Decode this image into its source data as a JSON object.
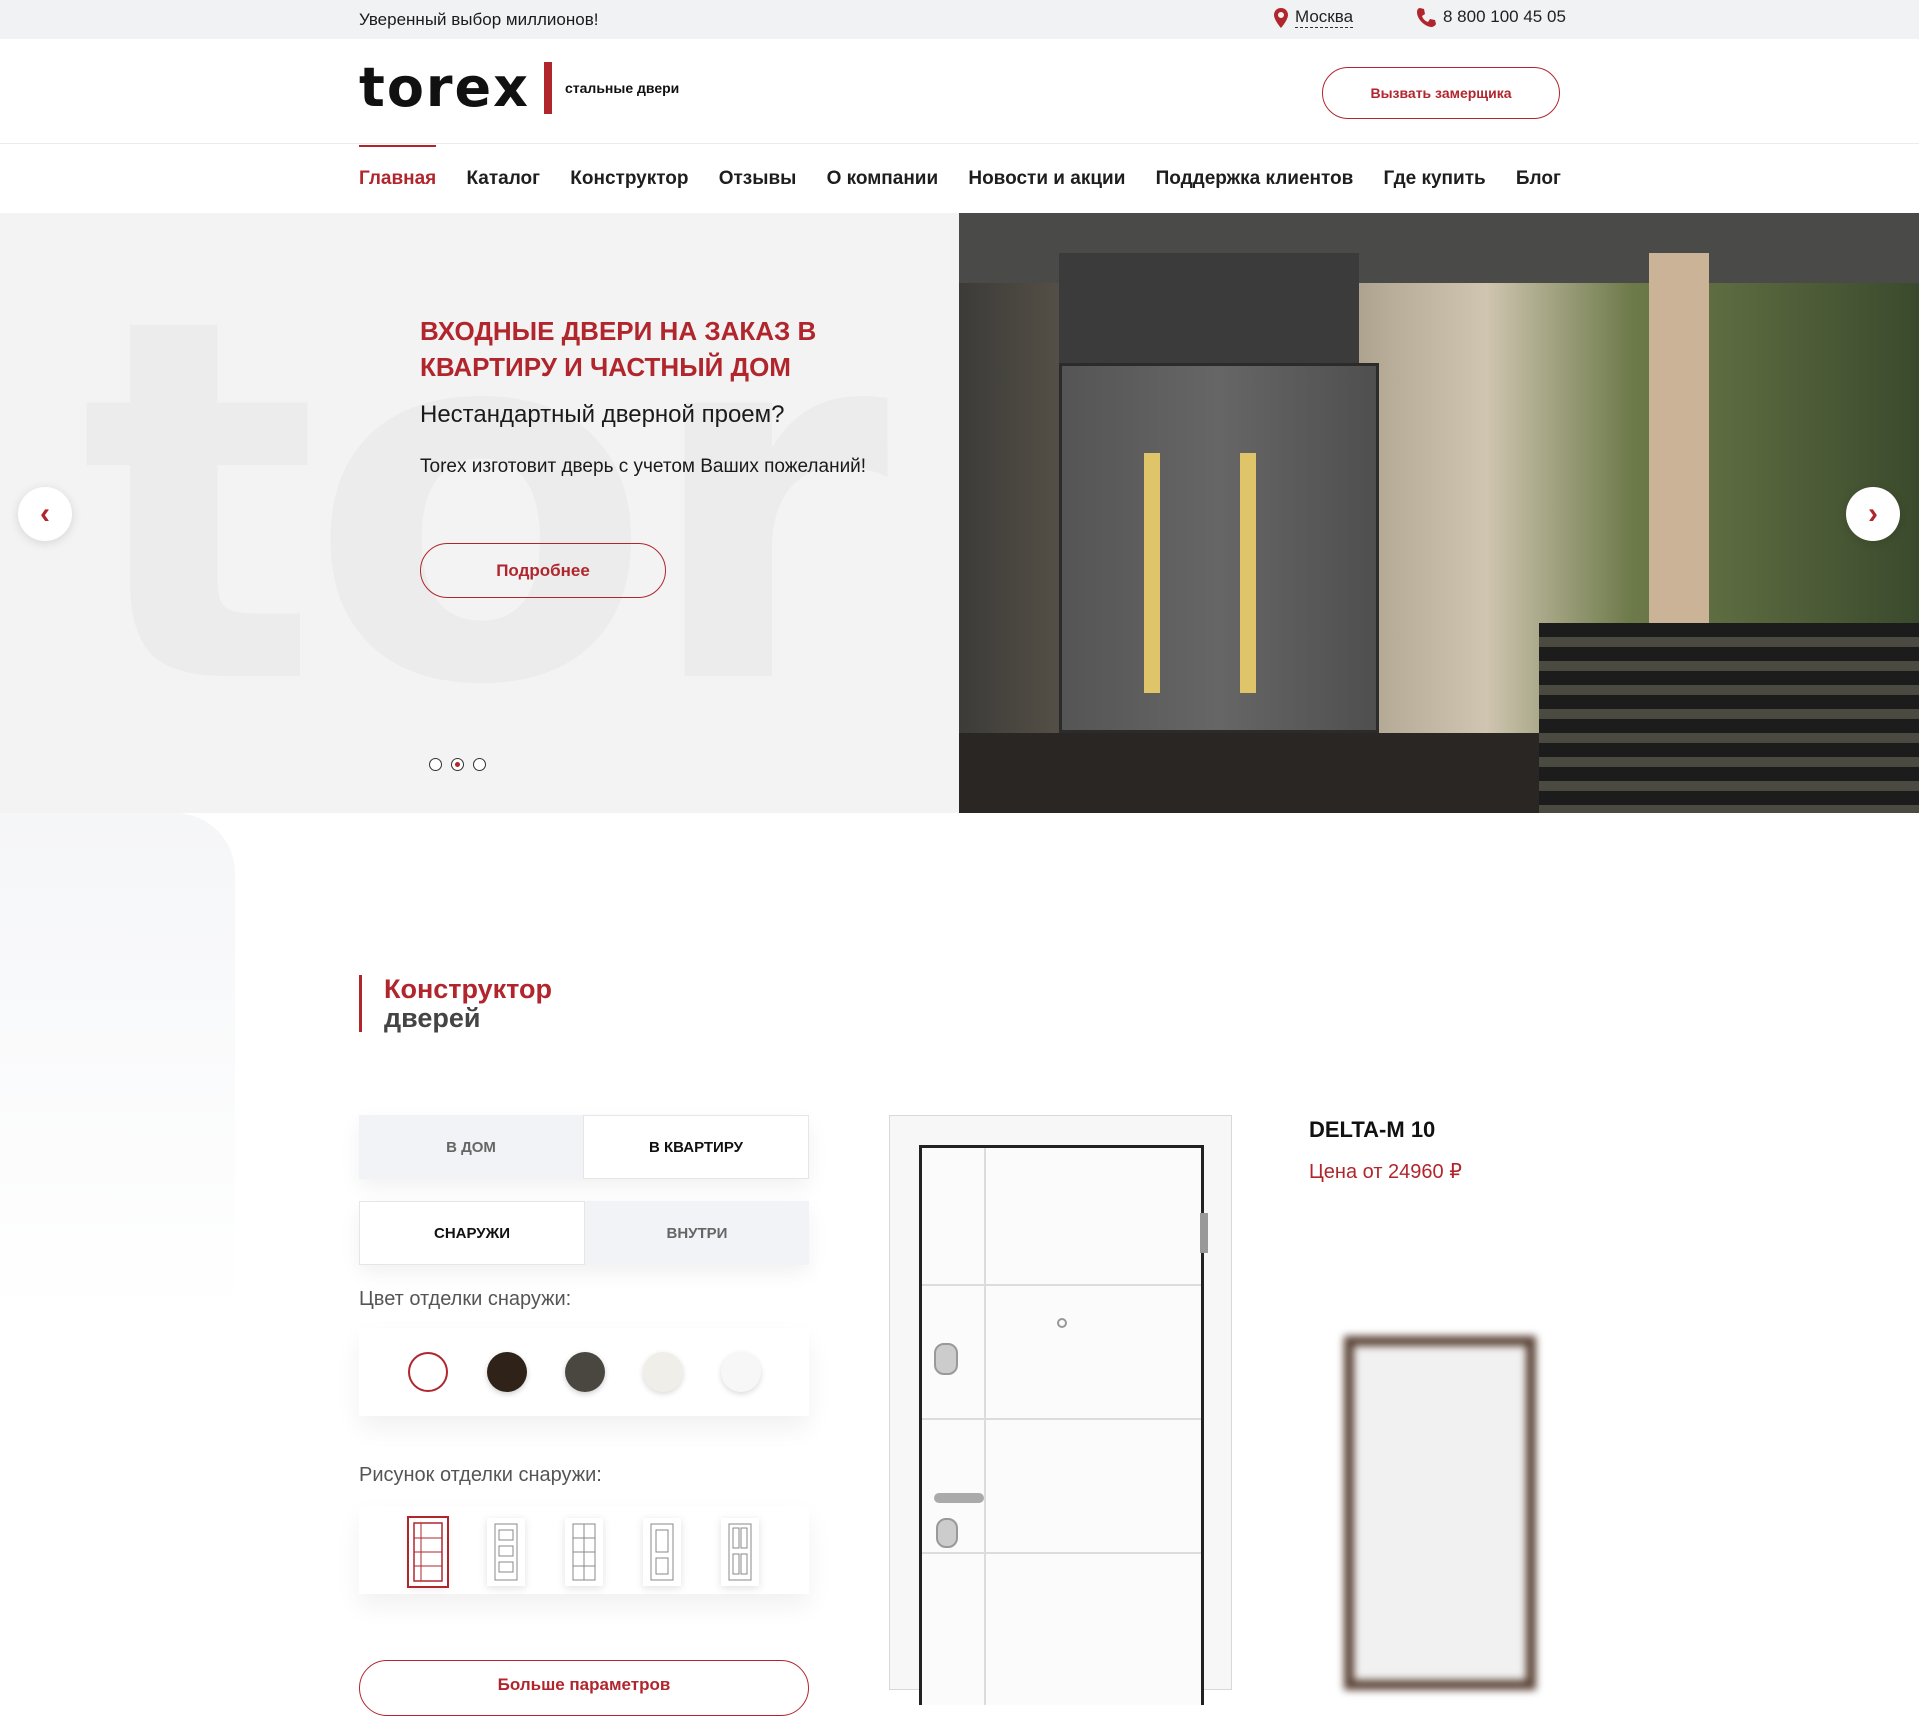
{
  "topbar": {
    "tagline": "Уверенный выбор миллионов!",
    "city": "Москва",
    "phone": "8 800 100 45 05"
  },
  "header": {
    "logo_text": "torex",
    "logo_sub": "стальные двери",
    "call_button": "Вызвать замерщика"
  },
  "nav": [
    {
      "label": "Главная",
      "active": true
    },
    {
      "label": "Каталог"
    },
    {
      "label": "Конструктор"
    },
    {
      "label": "Отзывы"
    },
    {
      "label": "О компании"
    },
    {
      "label": "Новости и акции"
    },
    {
      "label": "Поддержка клиентов"
    },
    {
      "label": "Где купить"
    },
    {
      "label": "Блог"
    }
  ],
  "hero": {
    "title": "ВХОДНЫЕ ДВЕРИ НА ЗАКАЗ В КВАРТИРУ И ЧАСТНЫЙ ДОМ",
    "subtitle": "Нестандартный дверной проем?",
    "text": "Torex изготовит дверь с учетом Ваших пожеланий!",
    "button": "Подробнее",
    "slides": 3,
    "active_slide": 2
  },
  "constructor": {
    "title_line1": "Конструктор",
    "title_line2": "дверей",
    "tabs_place": [
      {
        "label": "В ДОМ",
        "selected": false
      },
      {
        "label": "В КВАРТИРУ",
        "selected": true
      }
    ],
    "tabs_side": [
      {
        "label": "СНАРУЖИ",
        "selected": true
      },
      {
        "label": "ВНУТРИ",
        "selected": false
      }
    ],
    "color_label": "Цвет отделки снаружи:",
    "colors": [
      "#ffffff",
      "#2f2218",
      "#4a4741",
      "#efeee8",
      "#f7f7f7"
    ],
    "pattern_label": "Рисунок отделки снаружи:",
    "patterns": [
      "pattern-1",
      "pattern-2",
      "pattern-3",
      "pattern-4",
      "pattern-5"
    ],
    "more_params": "Больше параметров"
  },
  "product": {
    "name": "DELTA-M 10",
    "price": "Цена от 24960 ₽"
  },
  "colors": {
    "accent": "#b1262d"
  }
}
